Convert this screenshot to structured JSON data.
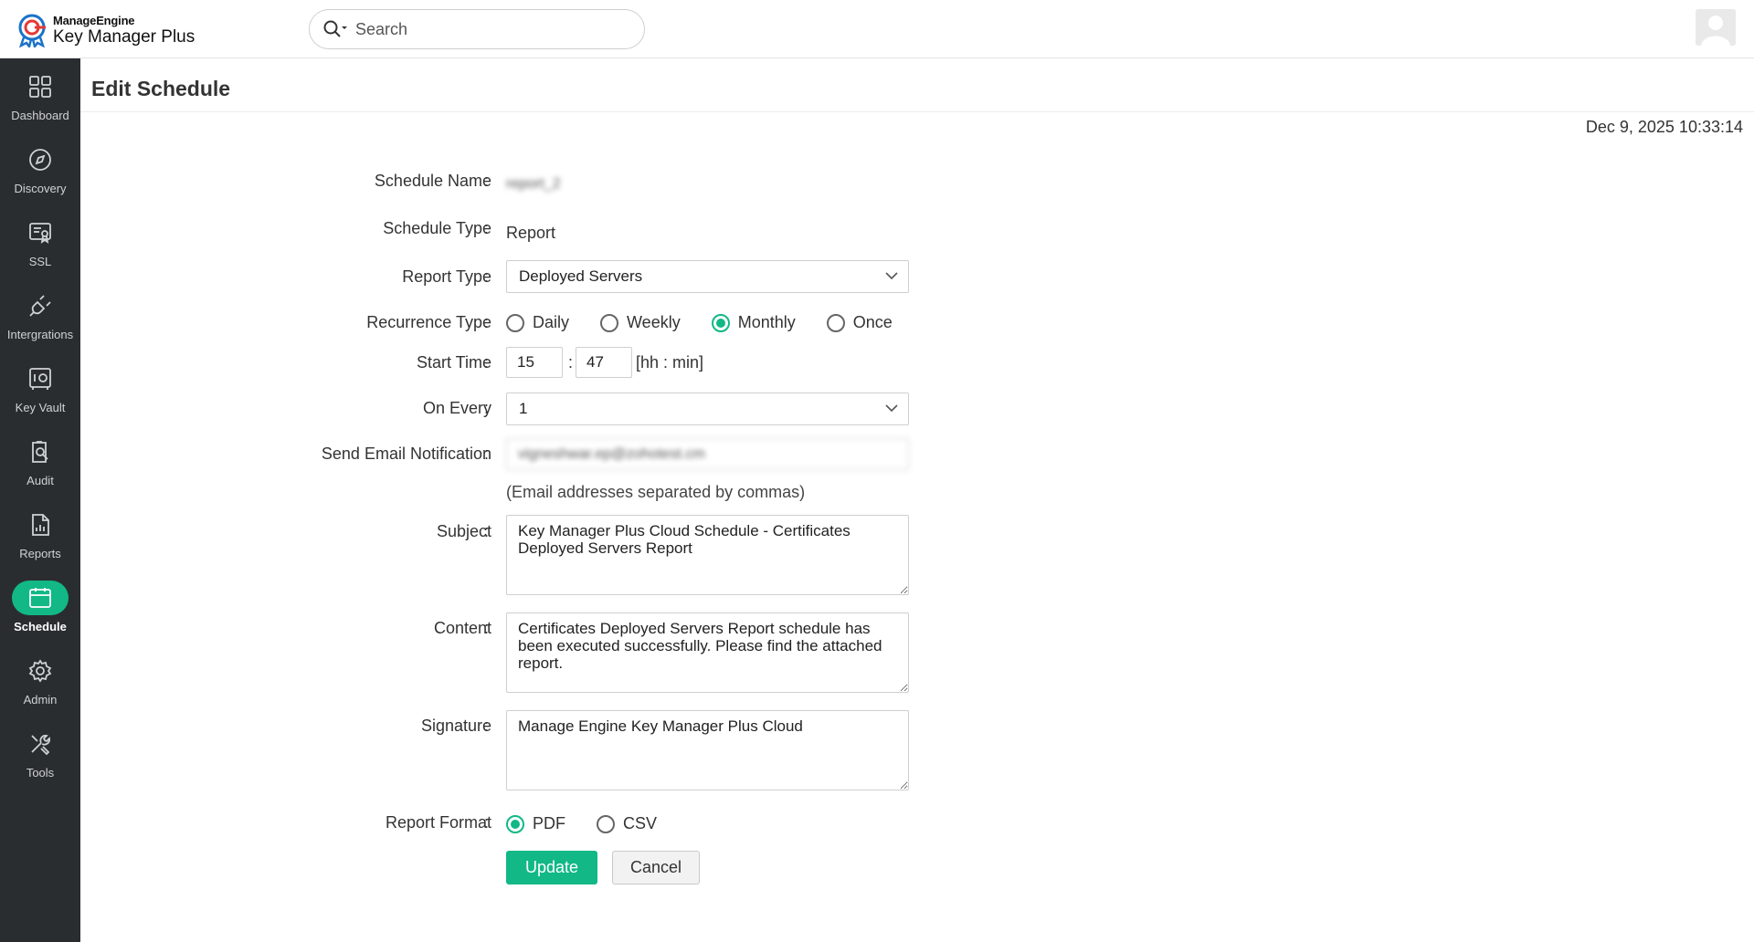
{
  "header": {
    "vendor": "ManageEngine",
    "product": "Key Manager Plus",
    "search_placeholder": "Search"
  },
  "sidebar": {
    "items": [
      {
        "label": "Dashboard",
        "icon": "dashboard-icon"
      },
      {
        "label": "Discovery",
        "icon": "compass-icon"
      },
      {
        "label": "SSL",
        "icon": "certificate-icon"
      },
      {
        "label": "Intergrations",
        "icon": "plug-icon"
      },
      {
        "label": "Key Vault",
        "icon": "vault-icon"
      },
      {
        "label": "Audit",
        "icon": "audit-icon"
      },
      {
        "label": "Reports",
        "icon": "report-icon"
      },
      {
        "label": "Schedule",
        "icon": "calendar-icon",
        "active": true
      },
      {
        "label": "Admin",
        "icon": "gear-icon"
      },
      {
        "label": "Tools",
        "icon": "tools-icon"
      }
    ]
  },
  "page": {
    "title": "Edit Schedule",
    "timestamp": "Dec 9, 2025 10:33:14"
  },
  "form": {
    "colon": ":",
    "schedule_name": {
      "label": "Schedule Name",
      "value": "report_2"
    },
    "schedule_type": {
      "label": "Schedule Type",
      "value": "Report"
    },
    "report_type": {
      "label": "Report Type",
      "value": "Deployed Servers"
    },
    "recurrence": {
      "label": "Recurrence Type",
      "options": [
        "Daily",
        "Weekly",
        "Monthly",
        "Once"
      ],
      "selected": "Monthly"
    },
    "start_time": {
      "label": "Start Time",
      "hour": "15",
      "minute": "47",
      "hint": "[hh : min]"
    },
    "on_every": {
      "label": "On Every",
      "value": "1"
    },
    "email": {
      "label": "Send Email Notification",
      "value": "vigneshwar.ep@zohotest.cm",
      "hint": "(Email addresses separated by commas)"
    },
    "subject": {
      "label": "Subject",
      "value": "Key Manager Plus Cloud Schedule - Certificates Deployed Servers Report"
    },
    "content": {
      "label": "Content",
      "value": "Certificates Deployed Servers Report schedule has been executed successfully. Please find the attached report."
    },
    "signature": {
      "label": "Signature",
      "value": "Manage Engine Key Manager Plus Cloud"
    },
    "report_format": {
      "label": "Report Format",
      "options": [
        "PDF",
        "CSV"
      ],
      "selected": "PDF"
    },
    "update_label": "Update",
    "cancel_label": "Cancel"
  },
  "colors": {
    "accent": "#12b886",
    "sidebar_bg": "#2a2d30"
  }
}
